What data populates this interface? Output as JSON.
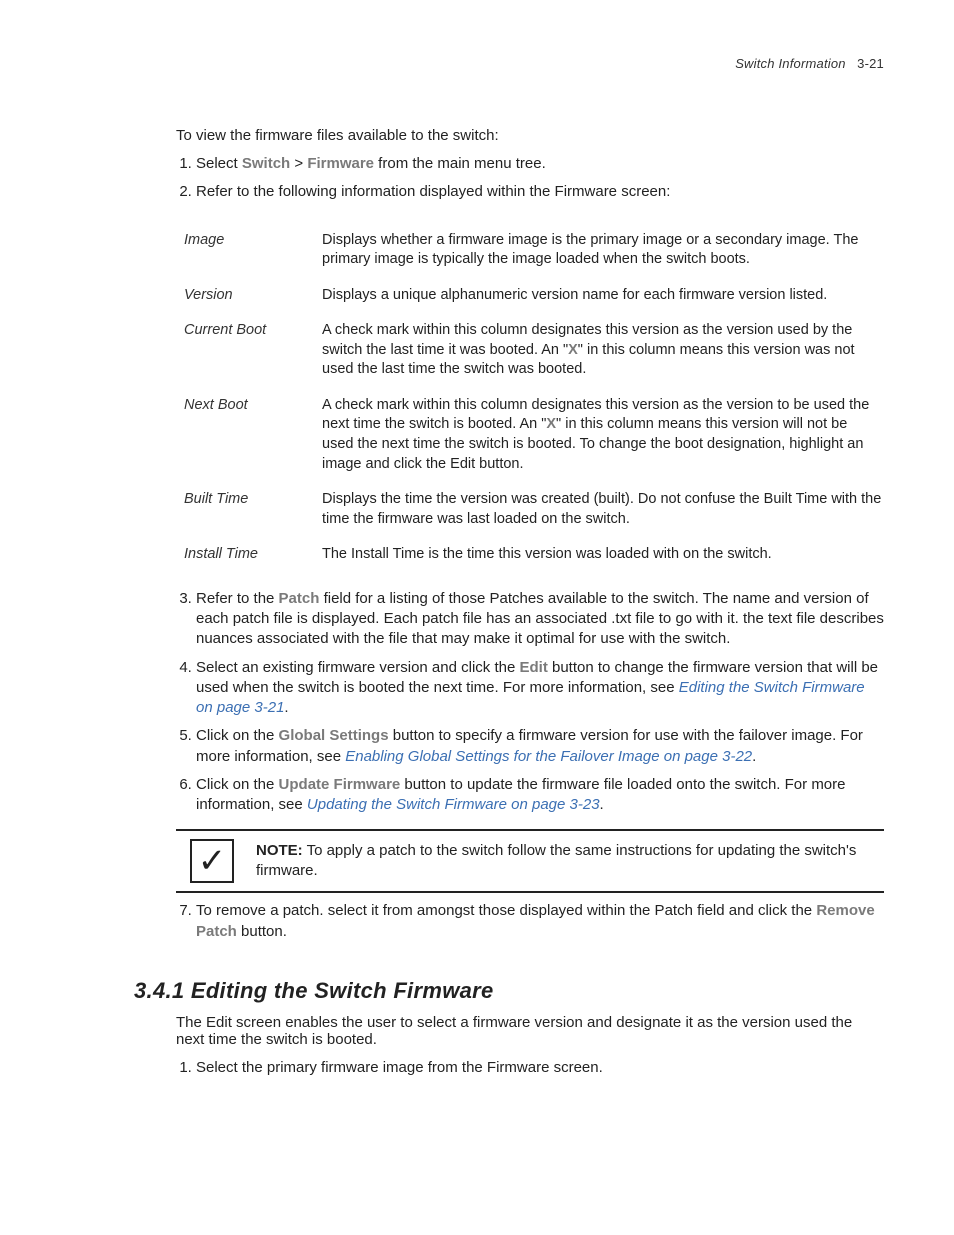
{
  "header": {
    "section": "Switch Information",
    "page": "3-21"
  },
  "intro": "To view the firmware files available to the switch:",
  "step1": {
    "pre": "Select ",
    "bold1": "Switch",
    "sep": " > ",
    "bold2": "Firmware",
    "post": " from the main menu tree."
  },
  "step2": "Refer to the following information displayed within the Firmware screen:",
  "defs": {
    "image": {
      "term": "Image",
      "desc": "Displays whether a firmware image is the primary image or a secondary image. The primary image is typically the image loaded when the switch boots."
    },
    "version": {
      "term": "Version",
      "desc": "Displays a unique alphanumeric version name for each firmware version listed."
    },
    "currentBoot": {
      "term": "Current Boot",
      "pre": "A check mark within this column designates this version as the version used by the switch the last time it was booted. An \"",
      "x": "X",
      "post": "\" in this column means this version was not used the last time the switch was booted."
    },
    "nextBoot": {
      "term": "Next Boot",
      "pre": "A check mark within this column designates this version as the version to be used the next time the switch is booted. An \"",
      "x": "X",
      "post": "\" in this column means this version will not be used the next time the switch is booted. To change the boot designation, highlight an image and click the Edit button."
    },
    "builtTime": {
      "term": "Built Time",
      "desc": "Displays the time the version was created (built). Do not confuse the Built Time with the time the firmware was last loaded on the switch."
    },
    "installTime": {
      "term": "Install Time",
      "desc": "The Install Time is the time this version was loaded with on the switch."
    }
  },
  "step3": {
    "pre": "Refer to the ",
    "bold": "Patch",
    "post": " field for a listing of those Patches available to the switch. The name and version of each patch file is displayed. Each patch file has an associated .txt file to go with it. the text file describes nuances associated with the file that may make it optimal for use with the switch."
  },
  "step4": {
    "pre": "Select an existing firmware version and click the ",
    "bold": "Edit",
    "mid": " button to change the firmware version that will be used when the switch is booted the next time. For more information, see ",
    "link": "Editing the Switch Firmware on page 3-21",
    "post": "."
  },
  "step5": {
    "pre": "Click on the ",
    "bold": "Global Settings",
    "mid": " button to specify a firmware version for use with the failover image. For more information, see ",
    "link": "Enabling Global Settings for the Failover Image on page 3-22",
    "post": "."
  },
  "step6": {
    "pre": "Click on the ",
    "bold": "Update Firmware",
    "mid": " button to update the firmware file loaded onto the switch. For more information, see ",
    "link": "Updating the Switch Firmware on page 3-23",
    "post": "."
  },
  "note": {
    "label": "NOTE:",
    "text": " To apply a patch to the switch follow the same instructions for updating the switch's firmware."
  },
  "step7": {
    "pre": "To remove a patch. select it from amongst those displayed within the Patch field and click the ",
    "bold": "Remove Patch",
    "post": " button."
  },
  "section341": {
    "heading": "3.4.1  Editing the Switch Firmware",
    "para": "The Edit screen enables the user to select a firmware version and designate it as the version used the next time the switch is booted.",
    "step1": "Select the primary firmware image from the Firmware screen."
  }
}
